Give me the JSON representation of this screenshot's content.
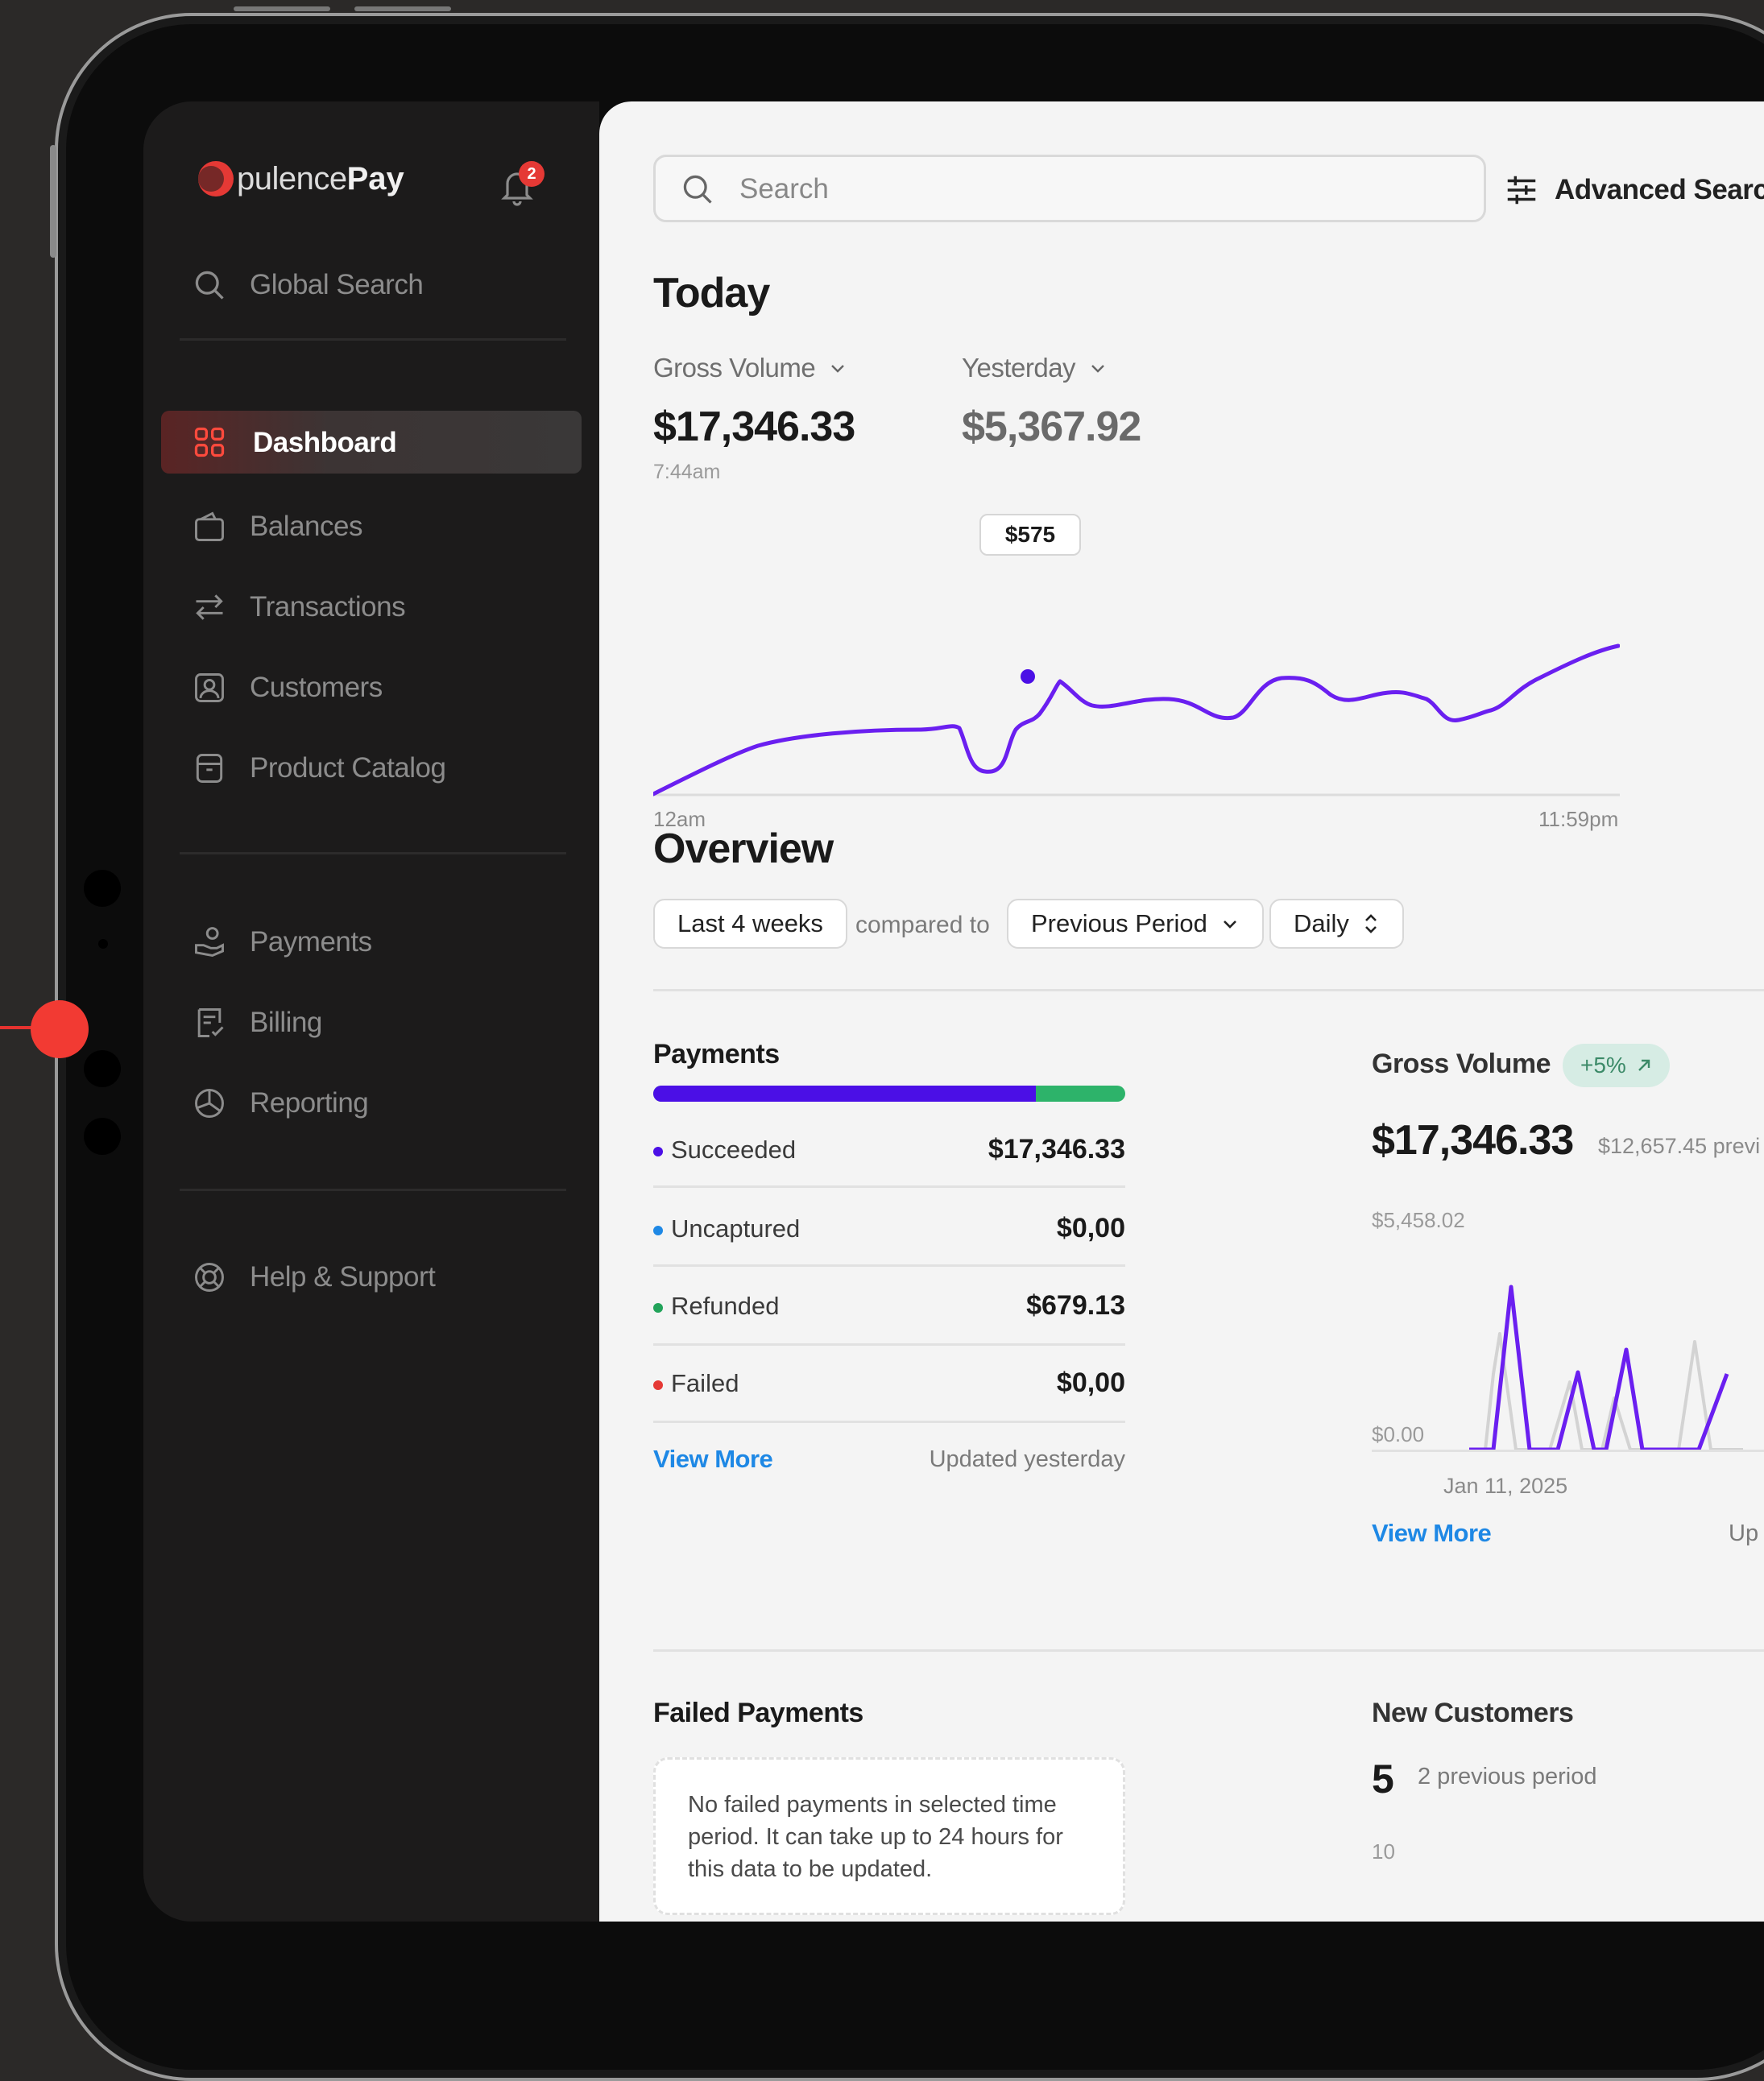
{
  "brand": {
    "name_light": "pulence",
    "name_bold": "Pay",
    "notification_count": "2"
  },
  "sidebar": {
    "search_label": "Global Search",
    "items_main": [
      {
        "label": "Dashboard",
        "icon": "grid-icon"
      },
      {
        "label": "Balances",
        "icon": "wallet-icon"
      },
      {
        "label": "Transactions",
        "icon": "arrows-icon"
      },
      {
        "label": "Customers",
        "icon": "user-card-icon"
      },
      {
        "label": "Product Catalog",
        "icon": "archive-icon"
      }
    ],
    "items_secondary": [
      {
        "label": "Payments",
        "icon": "hand-coin-icon"
      },
      {
        "label": "Billing",
        "icon": "receipt-icon"
      },
      {
        "label": "Reporting",
        "icon": "pie-chart-icon"
      }
    ],
    "help_label": "Help & Support"
  },
  "topbar": {
    "search_placeholder": "Search",
    "advanced_search_label": "Advanced Search"
  },
  "today": {
    "title": "Today",
    "metric_label": "Gross Volume",
    "metric_value": "$17,346.33",
    "metric_time": "7:44am",
    "compare_label": "Yesterday",
    "compare_value": "$5,367.92",
    "tooltip": "$575",
    "x_start": "12am",
    "x_end": "11:59pm"
  },
  "overview": {
    "title": "Overview",
    "range": "Last 4 weeks",
    "compared_to": "compared to",
    "period": "Previous Period",
    "interval": "Daily"
  },
  "payments": {
    "title": "Payments",
    "rows": [
      {
        "label": "Succeeded",
        "value": "$17,346.33",
        "color": "#4b0fe6"
      },
      {
        "label": "Uncaptured",
        "value": "$0,00",
        "color": "#1e88e5"
      },
      {
        "label": "Refunded",
        "value": "$679.13",
        "color": "#22a35a"
      },
      {
        "label": "Failed",
        "value": "$0,00",
        "color": "#e53935"
      }
    ],
    "view_more": "View More",
    "updated": "Updated yesterday"
  },
  "gross_volume": {
    "title": "Gross Volume",
    "badge": "+5%",
    "value": "$17,346.33",
    "previous": "$12,657.45 previ",
    "y_top": "$5,458.02",
    "y_bottom": "$0.00",
    "x_label": "Jan 11, 2025",
    "view_more": "View More",
    "updated": "Up"
  },
  "failed_payments": {
    "title": "Failed Payments",
    "message": "No failed payments in selected time period. It can take up to 24 hours for this data to be updated."
  },
  "new_customers": {
    "title": "New Customers",
    "count": "5",
    "previous": "2 previous period",
    "axis_top": "10"
  },
  "colors": {
    "accent_red": "#e53935",
    "line_purple": "#6a1ff0",
    "bar_purple": "#4b0fe6",
    "bar_green": "#2db36a",
    "link_blue": "#1e88e5"
  }
}
